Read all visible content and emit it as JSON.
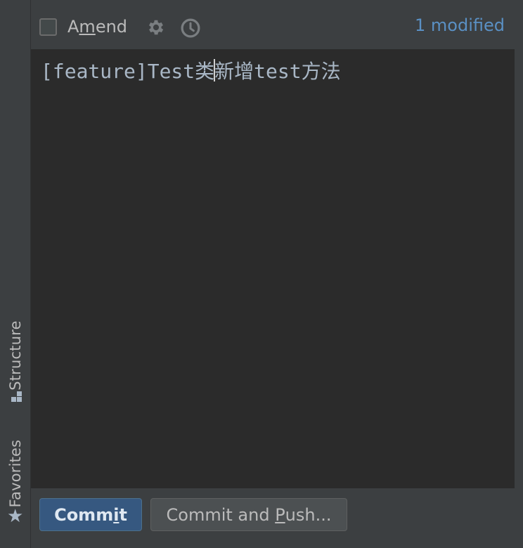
{
  "header": {
    "amend_label": "Amend",
    "modified_count": "1 modified"
  },
  "editor": {
    "message_before_caret": "[feature]Test类",
    "message_after_caret": "新增test方法"
  },
  "footer": {
    "commit_label": "Commit",
    "commit_push_label": "Commit and Push..."
  },
  "sidebar": {
    "tabs": [
      {
        "label": "Structure",
        "icon": "structure-icon"
      },
      {
        "label": "Favorites",
        "icon": "star-icon"
      }
    ]
  },
  "colors": {
    "background": "#3c3f41",
    "editor_bg": "#2b2b2b",
    "accent_link": "#5a90c4",
    "primary_button": "#365880"
  }
}
